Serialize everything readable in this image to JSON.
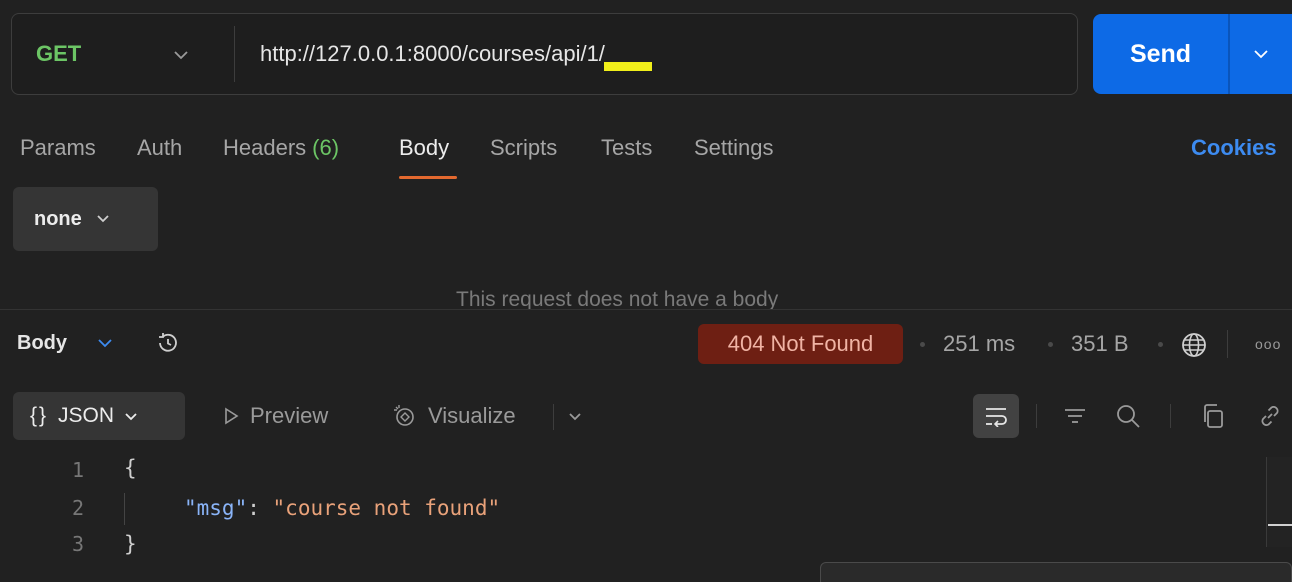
{
  "request": {
    "method": "GET",
    "url": "http://127.0.0.1:8000/courses/api/1/",
    "send_label": "Send"
  },
  "tabs": [
    {
      "label": "Params"
    },
    {
      "label": "Auth"
    },
    {
      "label": "Headers",
      "count": "(6)"
    },
    {
      "label": "Body",
      "active": true
    },
    {
      "label": "Scripts"
    },
    {
      "label": "Tests"
    },
    {
      "label": "Settings"
    }
  ],
  "cookies_label": "Cookies",
  "body": {
    "type": "none",
    "empty_message": "This request does not have a body"
  },
  "response": {
    "title": "Body",
    "status": "404 Not Found",
    "time": "251 ms",
    "size": "351 B",
    "format": "JSON",
    "format_brace": "{}",
    "preview_label": "Preview",
    "visualize_label": "Visualize",
    "more_label": "ooo",
    "lines": [
      "1",
      "2",
      "3"
    ],
    "json": {
      "open": "{",
      "key": "\"msg\"",
      "colon": ":",
      "value": "\"course not found\"",
      "close": "}"
    }
  },
  "colors": {
    "accent_blue": "#0d6ae6",
    "method_green": "#6cc565",
    "tab_underline": "#e3692f",
    "status_bg": "#6e1f13",
    "highlight": "#f1ef1a"
  },
  "icons": [
    "chevron-down-icon",
    "history-icon",
    "globe-icon",
    "play-icon",
    "visualize-icon",
    "wrap-lines-icon",
    "filter-icon",
    "search-icon",
    "copy-icon",
    "link-icon"
  ]
}
